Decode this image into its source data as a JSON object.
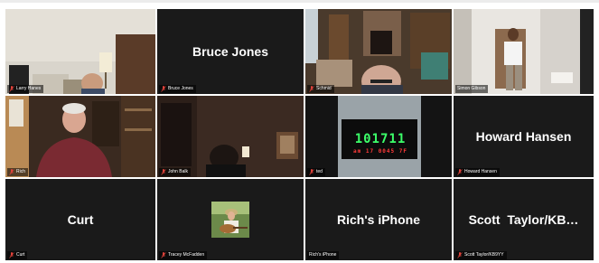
{
  "tiles": {
    "t1": {
      "name": "Larry Hanes",
      "muted": true,
      "video": true
    },
    "t2": {
      "name": "Bruce Jones",
      "muted": true,
      "video": false
    },
    "t3": {
      "name": "Schmid",
      "muted": true,
      "video": true
    },
    "t4": {
      "name": "Simon Gibson",
      "muted": false,
      "video": true,
      "active_speaker": true
    },
    "t5": {
      "name": "Rich",
      "muted": true,
      "video": true
    },
    "t6": {
      "name": "John Balk",
      "muted": true,
      "video": true
    },
    "t7": {
      "name": "ted",
      "muted": true,
      "video": true,
      "clock_digits": "101711",
      "clock_text": "am 17 0045 7F"
    },
    "t8": {
      "name": "Howard Hansen",
      "muted": true,
      "video": false
    },
    "t9": {
      "name": "Curt",
      "muted": true,
      "video": false
    },
    "t10": {
      "name": "Tracey McFadden",
      "muted": true,
      "video": false
    },
    "t11": {
      "name": "Rich's iPhone",
      "muted": false,
      "video": false
    },
    "t12": {
      "name": "Scott Taylor/KB9YY",
      "display_name": "Scott  Taylor/KB…",
      "muted": true,
      "video": false
    }
  },
  "colors": {
    "tile_bg": "#1a1a1a",
    "active_border": "#e6e64a",
    "muted_icon": "#e0433b",
    "led_green": "#3cff6a",
    "led_red": "#ff3a3a"
  }
}
